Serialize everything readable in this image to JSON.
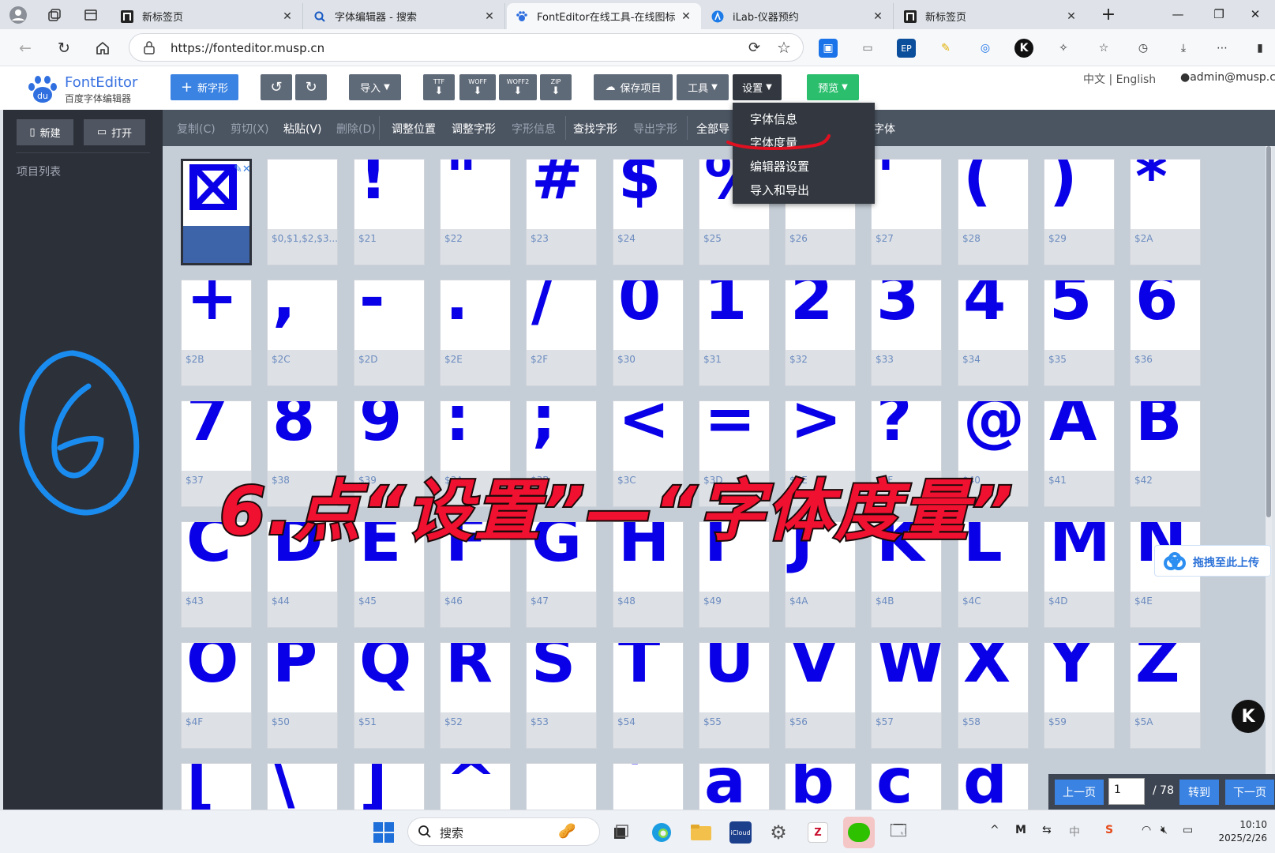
{
  "browser": {
    "tabs": [
      {
        "title": "新标签页"
      },
      {
        "title": "字体编辑器 - 搜索"
      },
      {
        "title": "FontEditor在线工具-在线图标"
      },
      {
        "title": "iLab-仪器预约"
      },
      {
        "title": "新标签页"
      }
    ],
    "url": "https://fonteditor.musp.cn"
  },
  "app": {
    "logo_title": "FontEditor",
    "logo_subtitle": "百度字体编辑器",
    "toolbar": {
      "new_glyph": "新字形",
      "import": "导入",
      "ttf": "TTF",
      "woff": "WOFF",
      "woff2": "WOFF2",
      "zip": "ZIP",
      "save_project": "保存项目",
      "tools": "工具",
      "settings": "设置",
      "preview": "预览"
    },
    "lang": "中文 | English",
    "user": "admin@musp.cn",
    "sidebar": {
      "new": "新建",
      "open": "打开",
      "title": "项目列表"
    },
    "edit_toolbar": {
      "copy": "复制(C)",
      "cut": "剪切(X)",
      "paste": "粘贴(V)",
      "delete": "删除(D)",
      "adjust_pos": "调整位置",
      "adjust_glyph": "调整字形",
      "glyph_info": "字形信息",
      "find_glyph": "查找字形",
      "export_glyph": "导出字形",
      "select_all": "全部导",
      "font": "字体"
    },
    "settings_menu": [
      "字体信息",
      "字体度量",
      "编辑器设置",
      "导入和导出"
    ],
    "glyphs": [
      {
        "g": "",
        "code": ""
      },
      {
        "g": "",
        "code": "$0,$1,$2,$3..."
      },
      {
        "g": "!",
        "code": "$21"
      },
      {
        "g": "\"",
        "code": "$22"
      },
      {
        "g": "#",
        "code": "$23"
      },
      {
        "g": "$",
        "code": "$24"
      },
      {
        "g": "%",
        "code": "$25"
      },
      {
        "g": "&",
        "code": "$26"
      },
      {
        "g": "'",
        "code": "$27"
      },
      {
        "g": "(",
        "code": "$28"
      },
      {
        "g": ")",
        "code": "$29"
      },
      {
        "g": "*",
        "code": "$2A"
      },
      {
        "g": "+",
        "code": "$2B"
      },
      {
        "g": ",",
        "code": "$2C"
      },
      {
        "g": "-",
        "code": "$2D"
      },
      {
        "g": ".",
        "code": "$2E"
      },
      {
        "g": "/",
        "code": "$2F"
      },
      {
        "g": "0",
        "code": "$30"
      },
      {
        "g": "1",
        "code": "$31"
      },
      {
        "g": "2",
        "code": "$32"
      },
      {
        "g": "3",
        "code": "$33"
      },
      {
        "g": "4",
        "code": "$34"
      },
      {
        "g": "5",
        "code": "$35"
      },
      {
        "g": "6",
        "code": "$36"
      },
      {
        "g": "7",
        "code": "$37"
      },
      {
        "g": "8",
        "code": "$38"
      },
      {
        "g": "9",
        "code": "$39"
      },
      {
        "g": ":",
        "code": "$3A"
      },
      {
        "g": ";",
        "code": "$3B"
      },
      {
        "g": "<",
        "code": "$3C"
      },
      {
        "g": "=",
        "code": "$3D"
      },
      {
        "g": ">",
        "code": "$3E"
      },
      {
        "g": "?",
        "code": "$3F"
      },
      {
        "g": "@",
        "code": "$40"
      },
      {
        "g": "A",
        "code": "$41"
      },
      {
        "g": "B",
        "code": "$42"
      },
      {
        "g": "C",
        "code": "$43"
      },
      {
        "g": "D",
        "code": "$44"
      },
      {
        "g": "E",
        "code": "$45"
      },
      {
        "g": "F",
        "code": "$46"
      },
      {
        "g": "G",
        "code": "$47"
      },
      {
        "g": "H",
        "code": "$48"
      },
      {
        "g": "I",
        "code": "$49"
      },
      {
        "g": "J",
        "code": "$4A"
      },
      {
        "g": "K",
        "code": "$4B"
      },
      {
        "g": "L",
        "code": "$4C"
      },
      {
        "g": "M",
        "code": "$4D"
      },
      {
        "g": "N",
        "code": "$4E"
      },
      {
        "g": "O",
        "code": "$4F"
      },
      {
        "g": "P",
        "code": "$50"
      },
      {
        "g": "Q",
        "code": "$51"
      },
      {
        "g": "R",
        "code": "$52"
      },
      {
        "g": "S",
        "code": "$53"
      },
      {
        "g": "T",
        "code": "$54"
      },
      {
        "g": "U",
        "code": "$55"
      },
      {
        "g": "V",
        "code": "$56"
      },
      {
        "g": "W",
        "code": "$57"
      },
      {
        "g": "X",
        "code": "$58"
      },
      {
        "g": "Y",
        "code": "$59"
      },
      {
        "g": "Z",
        "code": "$5A"
      },
      {
        "g": "[",
        "code": ""
      },
      {
        "g": "\\",
        "code": ""
      },
      {
        "g": "]",
        "code": ""
      },
      {
        "g": "^",
        "code": ""
      },
      {
        "g": "_",
        "code": ""
      },
      {
        "g": "`",
        "code": ""
      },
      {
        "g": "a",
        "code": ""
      },
      {
        "g": "b",
        "code": ""
      },
      {
        "g": "c",
        "code": ""
      },
      {
        "g": "d",
        "code": ""
      }
    ],
    "pager": {
      "prev": "上一页",
      "page": "1",
      "total": "/ 78",
      "goto": "转到",
      "next": "下一页"
    },
    "upload": "拖拽至此上传"
  },
  "overlay": {
    "caption": "6.点“设置”—“字体度量”"
  },
  "taskbar": {
    "search": "搜索",
    "time": "10:10",
    "date": "2025/2/26"
  },
  "colors": {
    "accent": "#3b83e2",
    "glyph": "#0a00e8",
    "sidebar": "#2c3039",
    "annotation": "#f01030"
  }
}
